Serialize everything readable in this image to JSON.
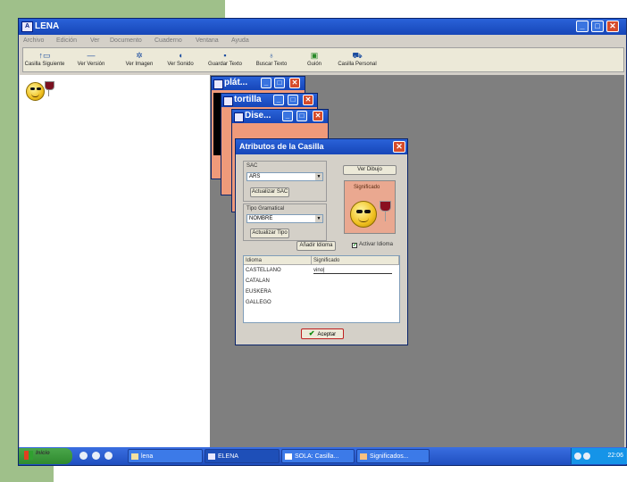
{
  "app": {
    "title": "LENA",
    "icon_letters": "A",
    "menu": [
      "Archivo",
      "Edición",
      "Ver",
      "Documento",
      "Cuaderno",
      "Ventana",
      "Ayuda"
    ],
    "toolbar": [
      {
        "label": "Casilla Siguiente",
        "icon": "arrow-up-icon"
      },
      {
        "label": "Ver Versión",
        "icon": "arrow-icon"
      },
      {
        "label": "Ver Imagen",
        "icon": "gear-icon"
      },
      {
        "label": "Ver Sonido",
        "icon": "speaker-icon"
      },
      {
        "label": "Guardar Texto",
        "icon": "floppy-icon"
      },
      {
        "label": "Buscar Texto",
        "icon": "search-icon"
      },
      {
        "label": "Guión",
        "icon": "script-icon"
      },
      {
        "label": "Casilla Personal",
        "icon": "casilla-icon"
      }
    ]
  },
  "bg_windows": [
    {
      "title": "plát..."
    },
    {
      "title": "tortilla"
    },
    {
      "title": "Dise..."
    }
  ],
  "dialog": {
    "title": "Atributos de la Casilla",
    "sac_label": "SAC",
    "sac_value": "ARS",
    "update_sac_btn": "Actualizar SAC",
    "view_drawing_btn": "Ver Dibujo",
    "image_caption": "Significado",
    "type_label": "Tipo Gramatical",
    "type_value": "NOMBRE",
    "update_type_btn": "Actualizar Tipo",
    "add_item_btn": "Añadir Idioma",
    "checkbox_label": "Activar Idioma",
    "checkbox_checked": true,
    "table": {
      "headers": [
        "Idioma",
        "Significado"
      ],
      "rows": [
        {
          "idioma": "CASTELLANO",
          "significado": "vino"
        },
        {
          "idioma": "CATALAN",
          "significado": ""
        },
        {
          "idioma": "EUSKERA",
          "significado": ""
        },
        {
          "idioma": "GALLEGO",
          "significado": ""
        }
      ]
    },
    "accept_btn": "Aceptar"
  },
  "taskbar": {
    "start_label": "Inicio",
    "tasks": [
      {
        "label": "lena"
      },
      {
        "label": "ELENA"
      },
      {
        "label": "SOLA: Casilla..."
      },
      {
        "label": "Significados..."
      }
    ],
    "clock": "22:06"
  },
  "colors": {
    "titlebar": "#1646b8",
    "desktop_gray": "#7f7f7f",
    "green": "#9fc08a"
  }
}
